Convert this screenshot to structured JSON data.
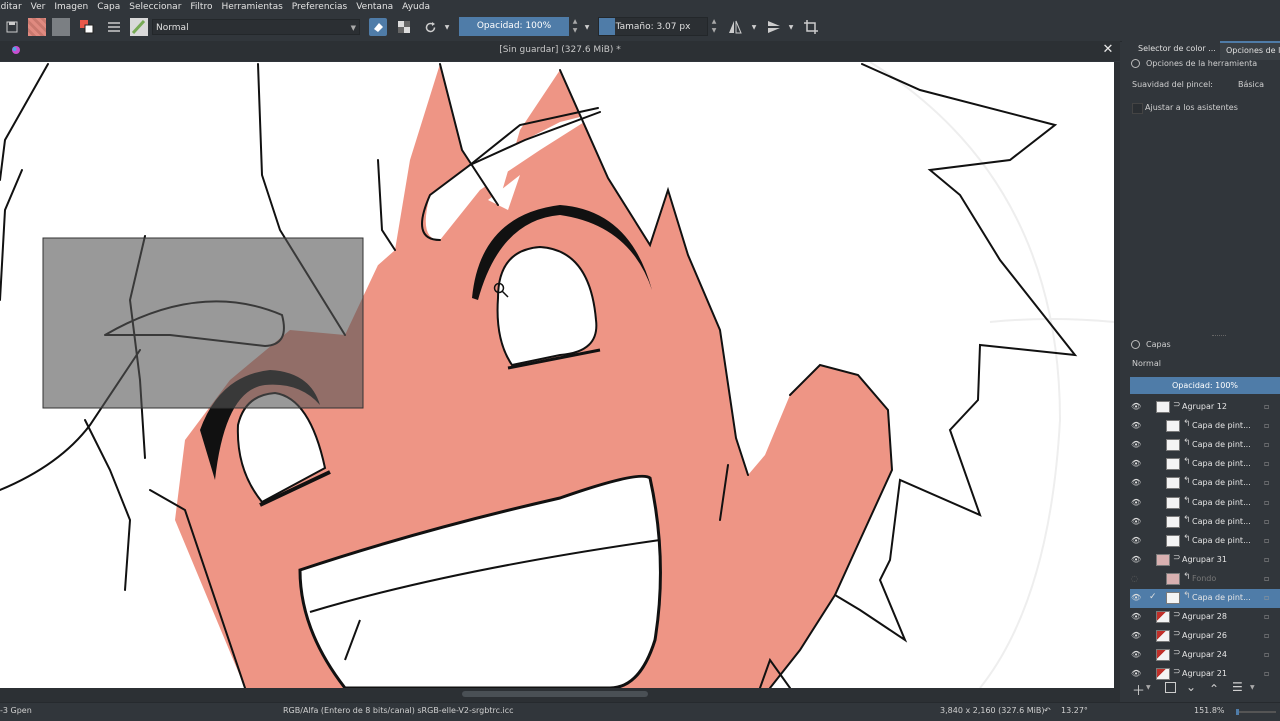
{
  "menu": [
    "Editar",
    "Ver",
    "Imagen",
    "Capa",
    "Seleccionar",
    "Filtro",
    "Herramientas",
    "Preferencias",
    "Ventana",
    "Ayuda"
  ],
  "toolbar": {
    "blend_mode": "Normal",
    "opacity_label": "Opacidad: 100%",
    "size_label": "Tamaño: 3.07 px"
  },
  "document": {
    "title": "[Sin guardar]  (327.6 MiB) *"
  },
  "docker_top": {
    "tab_color_selector": "Selector de color ...",
    "tab_tool_options": "Opciones de la",
    "title": "Opciones de la herramienta",
    "smoothing_label": "Suavidad del pincel:",
    "smoothing_value": "Básica",
    "assistants_label": "Ajustar a los asistentes"
  },
  "layers": {
    "title": "Capas",
    "blend_mode": "Normal",
    "opacity_label": "Opacidad:  100%",
    "items": [
      {
        "name": "Agrupar 12",
        "group": true,
        "indent": 0,
        "visible": true
      },
      {
        "name": "Capa de pint...",
        "group": false,
        "indent": 1,
        "visible": true
      },
      {
        "name": "Capa de pint...",
        "group": false,
        "indent": 1,
        "visible": true
      },
      {
        "name": "Capa de pint...",
        "group": false,
        "indent": 1,
        "visible": true
      },
      {
        "name": "Capa de pint...",
        "group": false,
        "indent": 1,
        "visible": true
      },
      {
        "name": "Capa de pint...",
        "group": false,
        "indent": 1,
        "visible": true
      },
      {
        "name": "Capa de pint...",
        "group": false,
        "indent": 1,
        "visible": true
      },
      {
        "name": "Capa de pint...",
        "group": false,
        "indent": 1,
        "visible": true
      },
      {
        "name": "Agrupar 31",
        "group": true,
        "indent": 0,
        "visible": true
      },
      {
        "name": "Fondo",
        "group": false,
        "indent": 1,
        "visible": false
      },
      {
        "name": "Capa de pint...",
        "group": false,
        "indent": 1,
        "visible": true,
        "selected": true
      },
      {
        "name": "Agrupar 28",
        "group": true,
        "indent": 0,
        "visible": true
      },
      {
        "name": "Agrupar 26",
        "group": true,
        "indent": 0,
        "visible": true
      },
      {
        "name": "Agrupar 24",
        "group": true,
        "indent": 0,
        "visible": true
      },
      {
        "name": "Agrupar 21",
        "group": true,
        "indent": 0,
        "visible": true
      }
    ]
  },
  "status": {
    "brush": "-3 Gpen",
    "color_space": "RGB/Alfa (Entero de 8 bits/canal)  sRGB-elle-V2-srgbtrc.icc",
    "image_size": "3,840 x 2,160 (327.6 MiB)",
    "rotation": "13.27°",
    "zoom": "151.8%"
  },
  "colors": {
    "skin": "#ee9585",
    "accent": "#4f7ca8",
    "ui_bg": "#31363b"
  }
}
